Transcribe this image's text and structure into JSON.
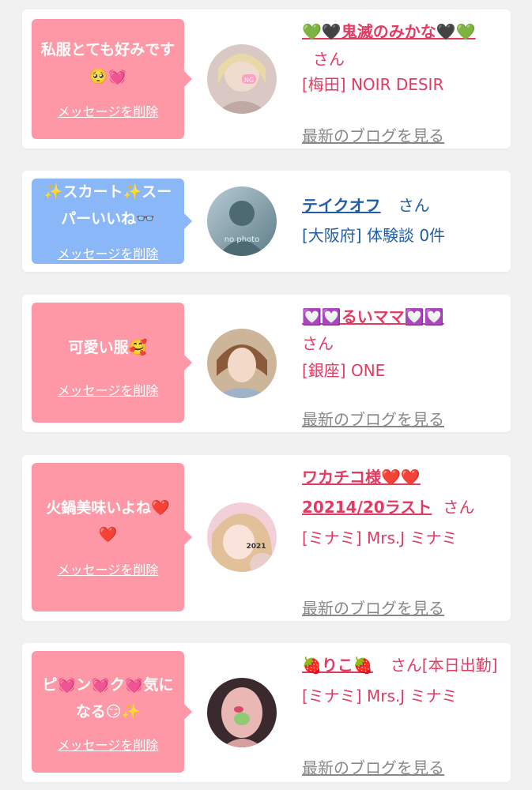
{
  "cards": [
    {
      "message": "私服とても好みです🥺💓",
      "delete_label": "メッセージを削除",
      "name": "💚🖤鬼滅のみかな🖤💚",
      "honorific": "さん",
      "shop": "[梅田] NOIR DESIR",
      "blog_link": "最新のブログを見る",
      "avatar_label": "NG"
    },
    {
      "message": "✨スカート✨スーパーいいね👓",
      "delete_label": "メッセージを削除",
      "name": "テイクオフ",
      "honorific": "さん",
      "shop": "[大阪府] 体験談 0件",
      "avatar_label": "no photo"
    },
    {
      "message": "可愛い服🥰",
      "delete_label": "メッセージを削除",
      "name": "💟💟るいママ💟💟",
      "honorific": "さん",
      "shop": "[銀座] ONE",
      "blog_link": "最新のブログを見る"
    },
    {
      "message": "火鍋美味いよね❤️❤️",
      "delete_label": "メッセージを削除",
      "name": "ワカチコ様❤️❤️20214/20ラスト",
      "honorific": "さん",
      "shop": "[ミナミ] Mrs.J ミナミ",
      "blog_link": "最新のブログを見る",
      "avatar_label": "2021"
    },
    {
      "message": "ピ💓ン💓ク💓気になる😏✨",
      "delete_label": "メッセージを削除",
      "name": "🍓りこ🍓",
      "honorific": "さん[本日出勤]",
      "shop": "[ミナミ] Mrs.J ミナミ",
      "blog_link": "最新のブログを見る"
    }
  ]
}
